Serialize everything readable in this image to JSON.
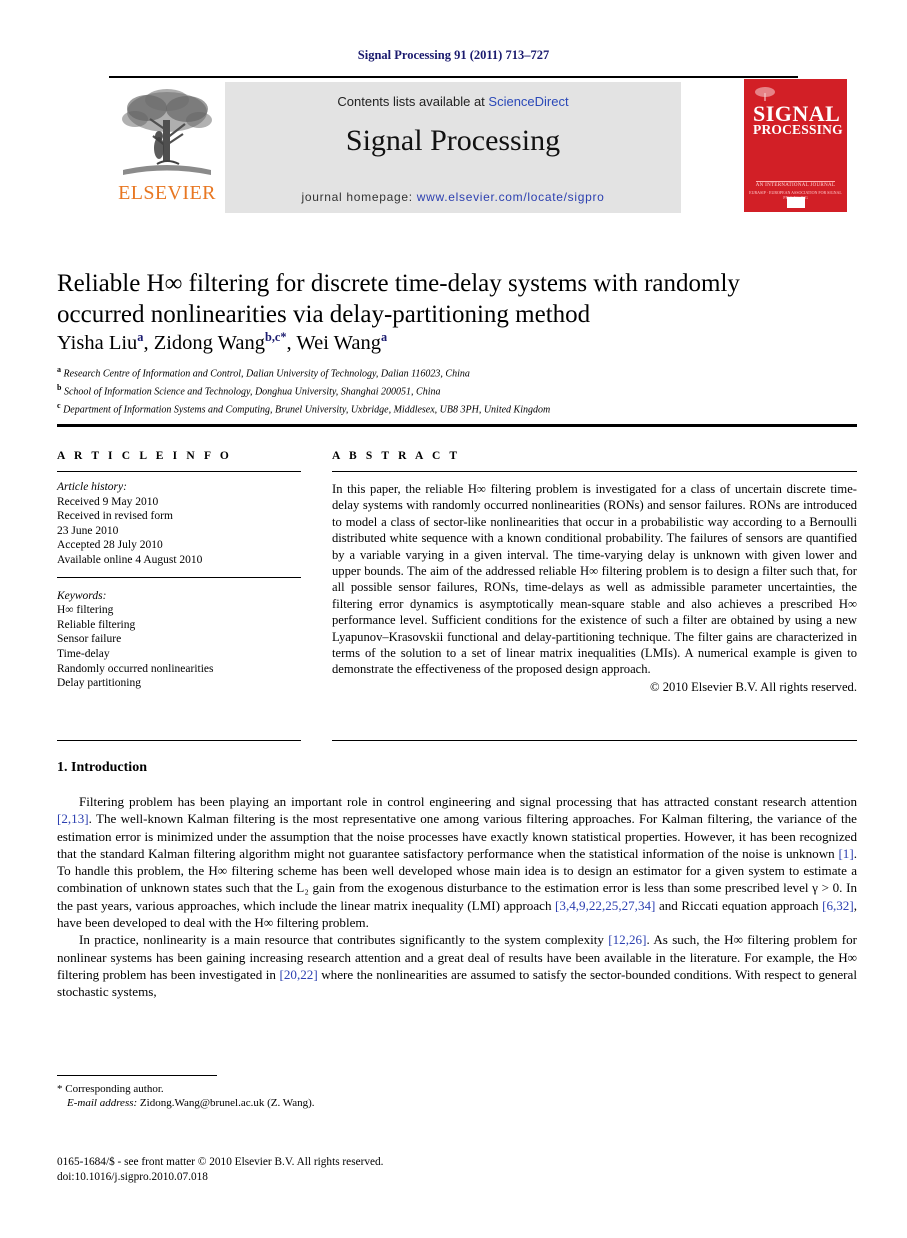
{
  "running_head": "Signal Processing 91 (2011) 713–727",
  "masthead": {
    "contents_prefix": "Contents lists available at ",
    "sciencedirect": "ScienceDirect",
    "journal_title": "Signal Processing",
    "homepage_prefix": "journal homepage: ",
    "homepage_url": "www.elsevier.com/locate/sigpro",
    "publisher_wordmark": "ELSEVIER",
    "cover": {
      "line1": "SIGNAL",
      "line2": "PROCESSING",
      "subtitle": "AN INTERNATIONAL JOURNAL",
      "subtitle2": "EURASIP · EUROPEAN ASSOCIATION FOR SIGNAL PROCESSING"
    }
  },
  "article": {
    "title_line1": "Reliable H∞ filtering for discrete time-delay systems with randomly",
    "title_line2": "occurred nonlinearities via delay-partitioning method",
    "authors_html": "Yisha Liu<sup>a</sup>, Zidong Wang<sup>b,c</sup><sup>*</sup>, Wei Wang<sup>a</sup>",
    "affiliations": [
      "Research Centre of Information and Control, Dalian University of Technology, Dalian 116023, China",
      "School of Information Science and Technology, Donghua University, Shanghai 200051, China",
      "Department of Information Systems and Computing, Brunel University, Uxbridge, Middlesex, UB8 3PH, United Kingdom"
    ],
    "affiliation_marks": [
      "a",
      "b",
      "c"
    ]
  },
  "article_info": {
    "heading": "A R T I C L E  I N F O",
    "history_label": "Article history:",
    "history": [
      "Received 9 May 2010",
      "Received in revised form",
      "23 June 2010",
      "Accepted 28 July 2010",
      "Available online 4 August 2010"
    ],
    "keywords_label": "Keywords:",
    "keywords": [
      "H∞ filtering",
      "Reliable filtering",
      "Sensor failure",
      "Time-delay",
      "Randomly occurred nonlinearities",
      "Delay partitioning"
    ]
  },
  "abstract": {
    "heading": "A B S T R A C T",
    "text": "In this paper, the reliable H∞ filtering problem is investigated for a class of uncertain discrete time-delay systems with randomly occurred nonlinearities (RONs) and sensor failures. RONs are introduced to model a class of sector-like nonlinearities that occur in a probabilistic way according to a Bernoulli distributed white sequence with a known conditional probability. The failures of sensors are quantified by a variable varying in a given interval. The time-varying delay is unknown with given lower and upper bounds. The aim of the addressed reliable H∞ filtering problem is to design a filter such that, for all possible sensor failures, RONs, time-delays as well as admissible parameter uncertainties, the filtering error dynamics is asymptotically mean-square stable and also achieves a prescribed H∞ performance level. Sufficient conditions for the existence of such a filter are obtained by using a new Lyapunov–Krasovskii functional and delay-partitioning technique. The filter gains are characterized in terms of the solution to a set of linear matrix inequalities (LMIs). A numerical example is given to demonstrate the effectiveness of the proposed design approach.",
    "copyright": "© 2010 Elsevier B.V. All rights reserved."
  },
  "section": {
    "number_title": "1.  Introduction",
    "paragraph1_parts": {
      "p1a": "Filtering problem has been playing an important role in control engineering and signal processing that has attracted constant research attention ",
      "c1": "[2,13]",
      "p1b": ". The well-known Kalman filtering is the most representative one among various filtering approaches. For Kalman filtering, the variance of the estimation error is minimized under the assumption that the noise processes have exactly known statistical properties. However, it has been recognized that the standard Kalman filtering algorithm might not guarantee satisfactory performance when the statistical information of the noise is unknown ",
      "c2": "[1]",
      "p1c": ". To handle this problem, the H∞ filtering scheme has been well developed whose main idea is to design an estimator for a given system to estimate a combination of unknown states such that the L₂ gain from the exogenous disturbance to the estimation error is less than some prescribed level γ > 0. In the past years, various approaches, which include the linear matrix inequality (LMI) approach ",
      "c3": "[3,4,9,22,25,27,34]",
      "p1d": " and Riccati equation approach ",
      "c4": "[6,32]",
      "p1e": ", have been developed to deal with the H∞ filtering problem."
    },
    "paragraph2_parts": {
      "p2a": "In practice, nonlinearity is a main resource that contributes significantly to the system complexity ",
      "c5": "[12,26]",
      "p2b": ". As such, the H∞ filtering problem for nonlinear systems has been gaining increasing research attention and a great deal of results have been available in the literature. For example, the H∞ filtering problem has been investigated in ",
      "c6": "[20,22]",
      "p2c": " where the nonlinearities are assumed to satisfy the sector-bounded conditions. With respect to general stochastic systems,"
    }
  },
  "footer": {
    "corresponding_mark": "*",
    "corresponding_text": " Corresponding author.",
    "email_label": "E-mail address:",
    "email_value": " Zidong.Wang@brunel.ac.uk (Z. Wang).",
    "issn_line": "0165-1684/$ - see front matter © 2010 Elsevier B.V. All rights reserved.",
    "doi_line": "doi:10.1016/j.sigpro.2010.07.018"
  },
  "colors": {
    "link_blue": "#2b3fb0",
    "running_head_blue": "#1a1a6e",
    "elsevier_orange": "#e87722",
    "cover_red": "#d21f26",
    "banner_gray": "#e3e3e3"
  }
}
